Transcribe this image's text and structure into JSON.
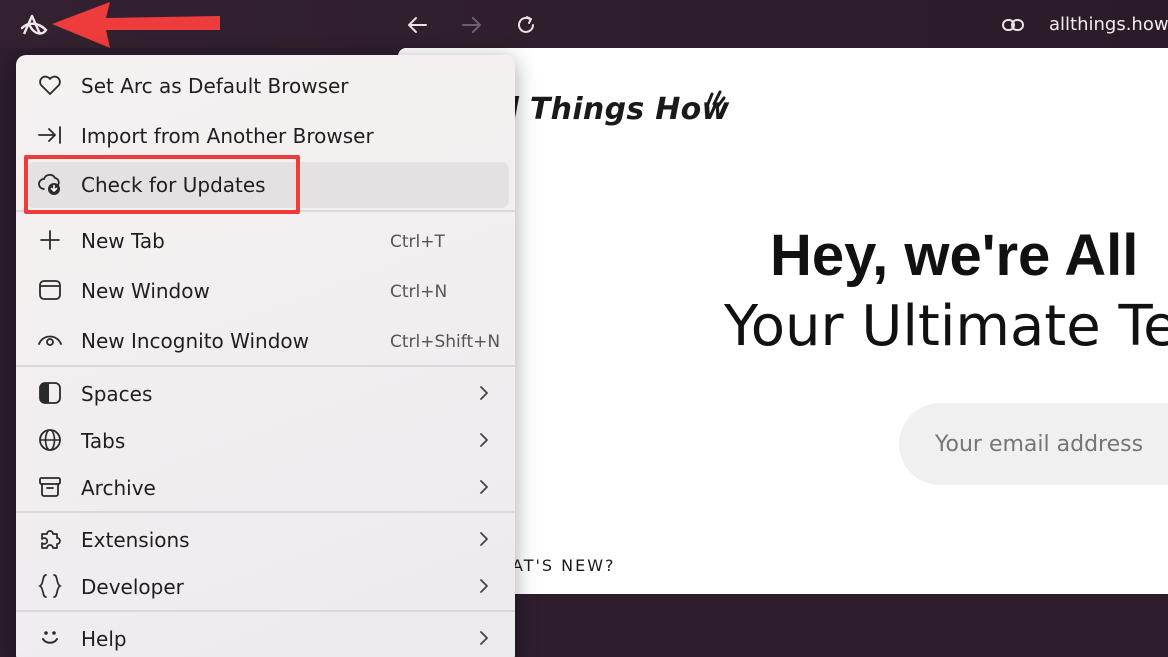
{
  "browser": {
    "url": "allthings.how",
    "icons": {
      "logo": "arc-logo-icon",
      "back": "arrow-left-icon",
      "forward": "arrow-right-icon",
      "reload": "reload-icon",
      "link": "link-icon"
    }
  },
  "webpage": {
    "logo_text": "ll Things How",
    "heading": "Hey, we're All",
    "subheading": "Your Ultimate Te",
    "email_placeholder": "Your email address",
    "whats_new": "AT'S NEW?"
  },
  "menu": {
    "items": [
      {
        "label": "Set Arc as Default Browser",
        "icon": "heart-icon"
      },
      {
        "label": "Import from Another Browser",
        "icon": "import-icon"
      },
      {
        "label": "Check for Updates",
        "icon": "cloud-download-icon"
      },
      {
        "label": "New Tab",
        "icon": "plus-icon",
        "shortcut": "Ctrl+T"
      },
      {
        "label": "New Window",
        "icon": "window-icon",
        "shortcut": "Ctrl+N"
      },
      {
        "label": "New Incognito Window",
        "icon": "incognito-eye-icon",
        "shortcut": "Ctrl+Shift+N"
      },
      {
        "label": "Spaces",
        "icon": "spaces-icon",
        "submenu": true
      },
      {
        "label": "Tabs",
        "icon": "globe-icon",
        "submenu": true
      },
      {
        "label": "Archive",
        "icon": "archive-icon",
        "submenu": true
      },
      {
        "label": "Extensions",
        "icon": "puzzle-icon",
        "submenu": true
      },
      {
        "label": "Developer",
        "icon": "braces-icon",
        "submenu": true
      },
      {
        "label": "Help",
        "icon": "smile-icon",
        "submenu": true
      }
    ]
  },
  "colors": {
    "annotation": "#ee3b3b",
    "titlebar": "#2f1e2c",
    "menu_bg": "#f3eff0"
  }
}
